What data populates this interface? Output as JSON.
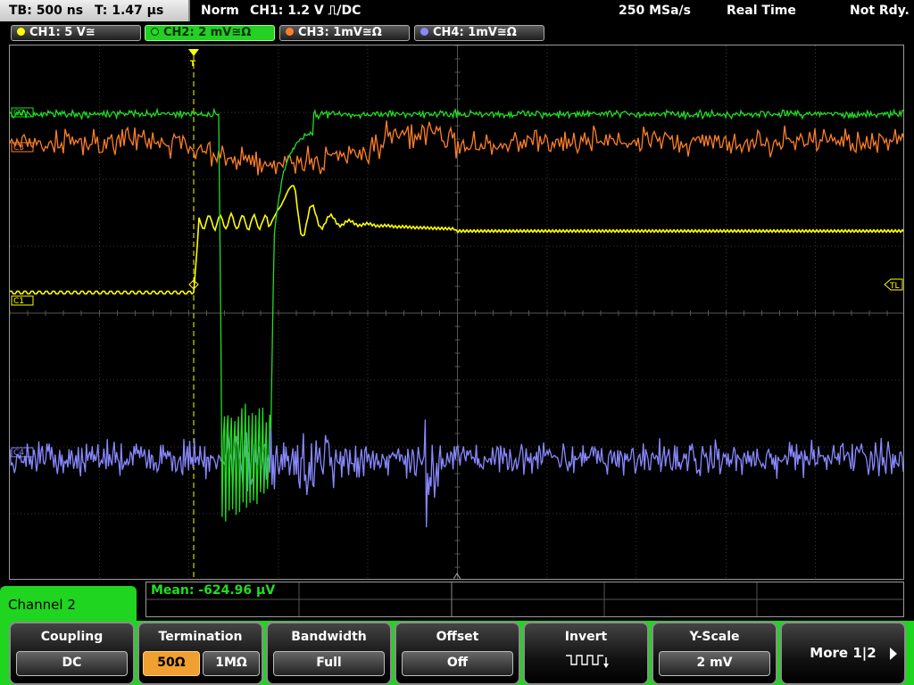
{
  "header": {
    "timebase": "TB: 500 ns",
    "trigger_time": "T: 1.47 µs",
    "trigger_mode": "Norm",
    "trigger_info": "CH1: 1.2 V ⎍/DC",
    "sample_rate": "250 MSa/s",
    "acq_mode": "Real Time",
    "status": "Not Rdy."
  },
  "channels": [
    {
      "label": "CH1: 5 V≅",
      "color": "#ffff00",
      "active": false
    },
    {
      "label": "CH2: 2 mV≅Ω",
      "color": "#22dd22",
      "active": true
    },
    {
      "label": "CH3: 1mV≅Ω",
      "color": "#ff7f27",
      "active": false
    },
    {
      "label": "CH4: 1mV≅Ω",
      "color": "#8888ff",
      "active": false
    }
  ],
  "markers": {
    "c1": "C1",
    "c2": "C2",
    "c3": "C3",
    "c4": "C4",
    "tl": "TL",
    "trigger": "T"
  },
  "measurement": {
    "text": "Mean: -624.96 µV"
  },
  "menu": {
    "title": "Channel 2",
    "coupling": {
      "title": "Coupling",
      "value": "DC"
    },
    "termination": {
      "title": "Termination",
      "opt1": "50Ω",
      "opt2": "1MΩ",
      "selected": "50Ω"
    },
    "bandwidth": {
      "title": "Bandwidth",
      "value": "Full"
    },
    "offset": {
      "title": "Offset",
      "value": "Off"
    },
    "invert": {
      "title": "Invert"
    },
    "yscale": {
      "title": "Y-Scale",
      "value": "2 mV"
    },
    "more": "More 1|2"
  },
  "colors": {
    "ch1": "#ffff00",
    "ch2": "#22dd22",
    "ch3": "#ff7f27",
    "ch4": "#8888ff",
    "accent": "#1fd51f"
  }
}
